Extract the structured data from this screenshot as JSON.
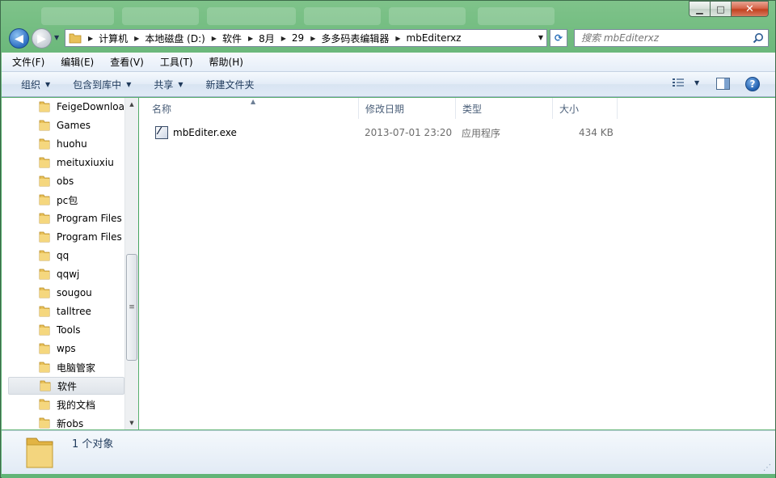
{
  "window": {
    "accent": "#3fa05a",
    "caption_buttons": {
      "minimize": "▁",
      "maximize": "□",
      "close": "✕"
    }
  },
  "nav": {
    "back_glyph": "◀",
    "forward_glyph": "▶",
    "recent_glyph": "▼",
    "refresh_glyph": "⟳"
  },
  "address": {
    "breadcrumbs": [
      "计算机",
      "本地磁盘 (D:)",
      "软件",
      "8月",
      "29",
      "多多码表编辑器",
      "mbEditerxz"
    ],
    "dropdown_glyph": "▼"
  },
  "search": {
    "placeholder": "搜索 mbEditerxz"
  },
  "menu": {
    "file": "文件(F)",
    "edit": "编辑(E)",
    "view": "查看(V)",
    "tools": "工具(T)",
    "help": "帮助(H)"
  },
  "commands": {
    "organize": "组织",
    "include_in_library": "包含到库中",
    "share": "共享",
    "new_folder": "新建文件夹",
    "view_icon": "view-list-icon",
    "help_glyph": "?"
  },
  "nav_pane": {
    "items": [
      {
        "label": "FeigeDownloa"
      },
      {
        "label": "Games"
      },
      {
        "label": "huohu"
      },
      {
        "label": "meituxiuxiu"
      },
      {
        "label": "obs"
      },
      {
        "label": "pc包"
      },
      {
        "label": "Program Files"
      },
      {
        "label": "Program Files"
      },
      {
        "label": "qq"
      },
      {
        "label": "qqwj"
      },
      {
        "label": "sougou"
      },
      {
        "label": "talltree"
      },
      {
        "label": "Tools"
      },
      {
        "label": "wps"
      },
      {
        "label": "电脑管家"
      },
      {
        "label": "软件"
      },
      {
        "label": "我的文档"
      },
      {
        "label": "新obs"
      }
    ],
    "selected_label": "软件"
  },
  "file_list": {
    "columns": {
      "name": "名称",
      "modified": "修改日期",
      "type": "类型",
      "size": "大小"
    },
    "rows": [
      {
        "name": "mbEditer.exe",
        "modified": "2013-07-01 23:20",
        "type": "应用程序",
        "size": "434 KB"
      }
    ]
  },
  "details": {
    "count": "1 个对象"
  }
}
